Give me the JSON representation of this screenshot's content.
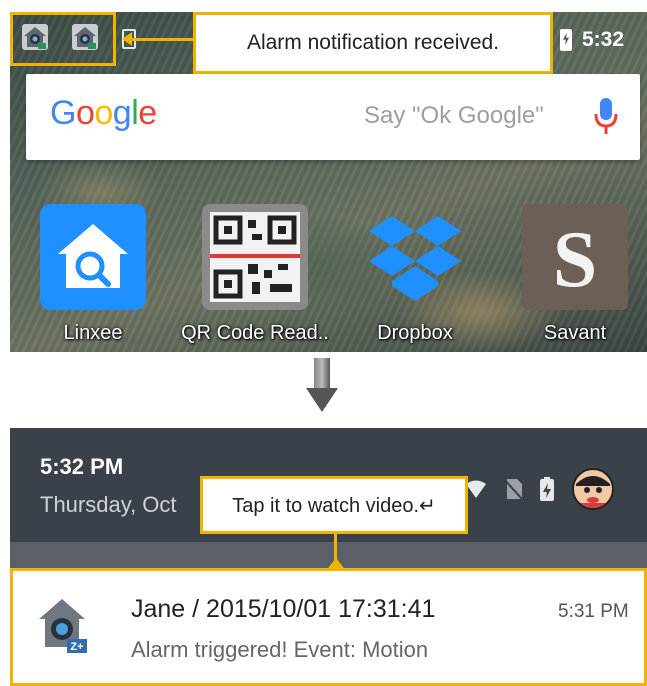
{
  "home_screen": {
    "callout_text": "Alarm notification received.",
    "clock": "5:32",
    "search": {
      "logo": "Google",
      "hint": "Say \"Ok Google\""
    },
    "apps": [
      {
        "label": "Linxee",
        "icon": "linxee-house-icon"
      },
      {
        "label": "QR Code Read..",
        "icon": "qr-code-icon"
      },
      {
        "label": "Dropbox",
        "icon": "dropbox-icon"
      },
      {
        "label": "Savant",
        "icon": "savant-s-icon"
      }
    ]
  },
  "shade": {
    "time": "5:32 PM",
    "date": "Thursday, Oct",
    "callout_text": "Tap it to watch video.↵",
    "notification": {
      "title": "Jane / 2015/10/01 17:31:41",
      "time": "5:31 PM",
      "text": "Alarm triggered! Event: Motion",
      "icon": "camera-house-icon"
    }
  },
  "colors": {
    "highlight": "#f0b400",
    "shade_header": "#3a4148",
    "app_blue": "#1e90ff"
  }
}
